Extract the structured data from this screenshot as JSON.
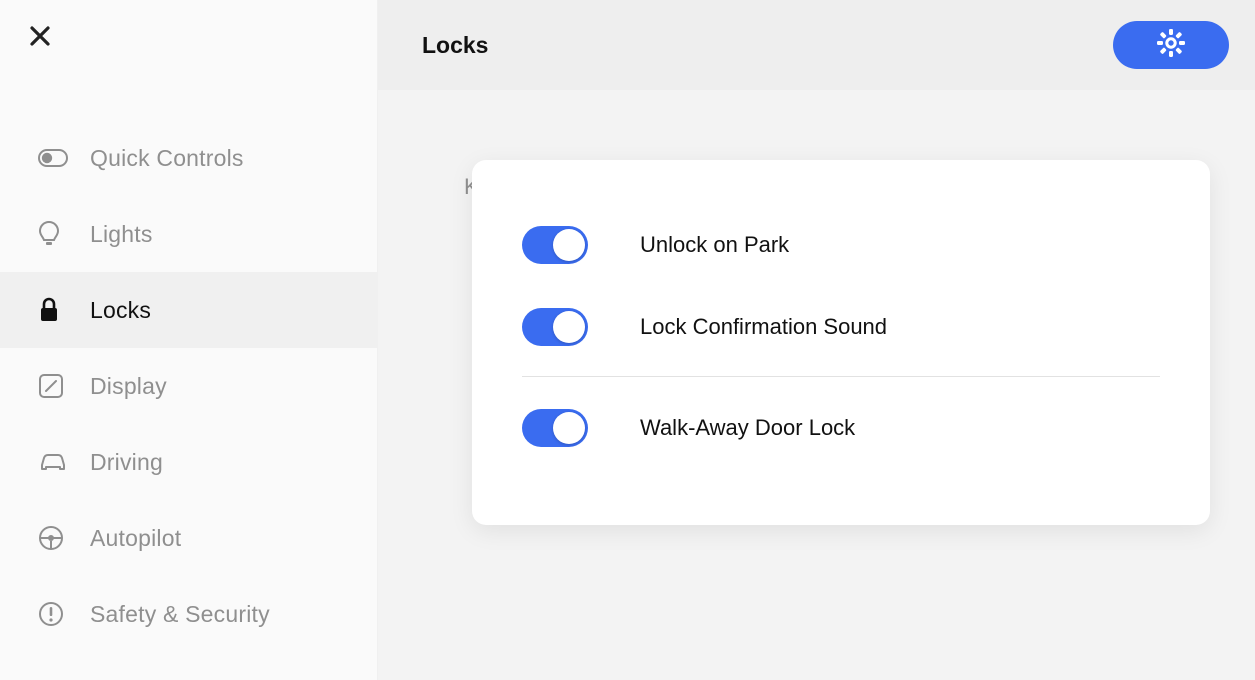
{
  "header": {
    "title": "Locks"
  },
  "sidebar": {
    "items": [
      {
        "label": "Quick Controls",
        "icon": "pill",
        "active": false
      },
      {
        "label": "Lights",
        "icon": "bulb",
        "active": false
      },
      {
        "label": "Locks",
        "icon": "lock",
        "active": true
      },
      {
        "label": "Display",
        "icon": "display",
        "active": false
      },
      {
        "label": "Driving",
        "icon": "car",
        "active": false
      },
      {
        "label": "Autopilot",
        "icon": "steering",
        "active": false
      },
      {
        "label": "Safety & Security",
        "icon": "alert",
        "active": false
      }
    ]
  },
  "hintLetter": "K",
  "card": {
    "settings": [
      {
        "label": "Unlock on Park",
        "on": true
      },
      {
        "label": "Lock Confirmation Sound",
        "on": true
      },
      {
        "label": "Walk-Away Door Lock",
        "on": true
      }
    ]
  },
  "colors": {
    "accent": "#3a6cf0",
    "inactive": "#8f8f8f",
    "active": "#111"
  }
}
